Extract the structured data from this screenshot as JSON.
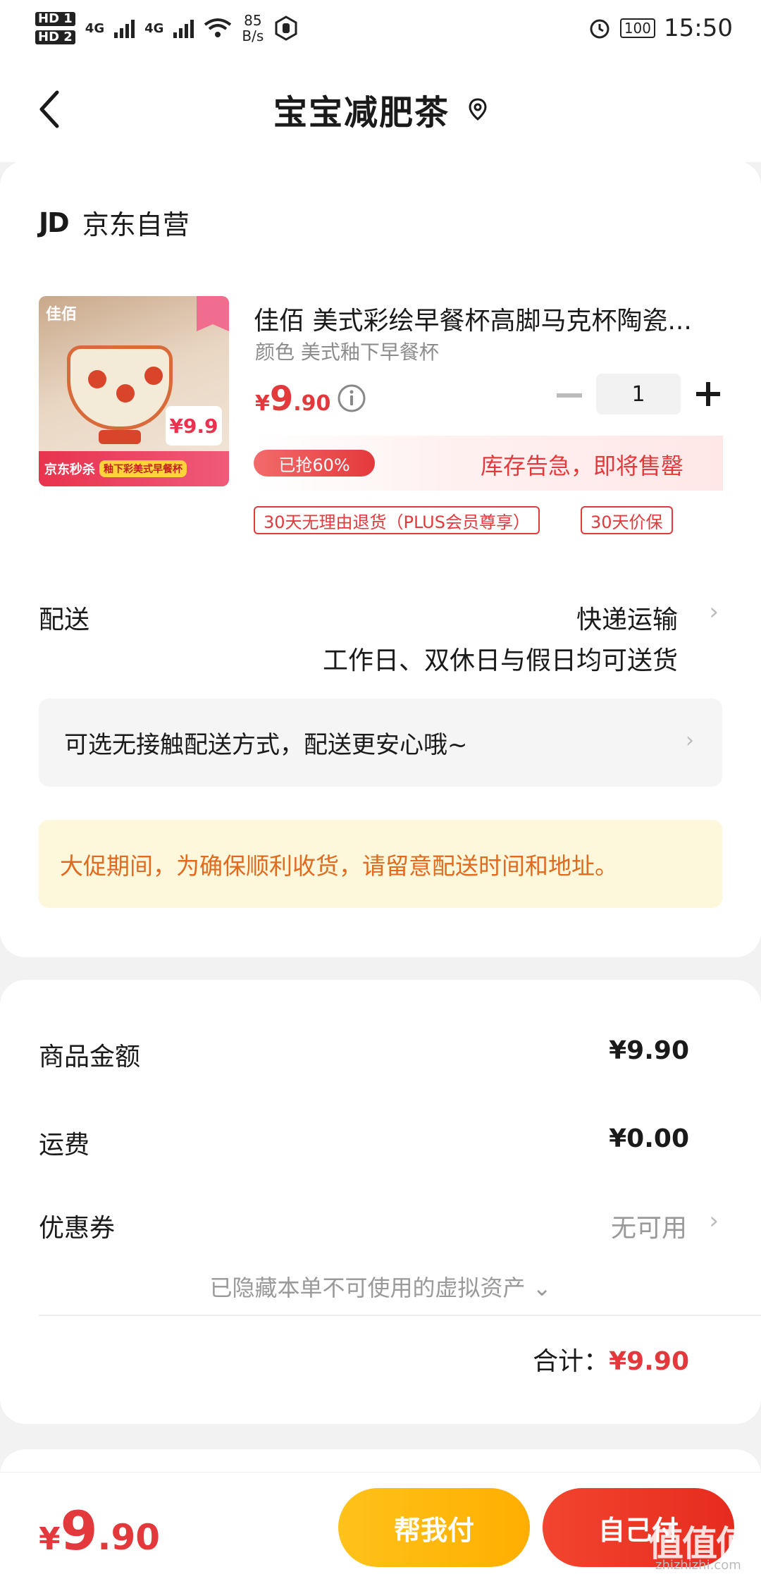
{
  "status_bar": {
    "hd1": "HD 1",
    "hd2": "HD 2",
    "net1": "4G",
    "net2": "4G",
    "speed_value": "85",
    "speed_unit": "B/s",
    "battery": "100",
    "time": "15:50"
  },
  "header": {
    "title": "宝宝减肥茶"
  },
  "shop": {
    "logo": "JD",
    "name": "京东自营"
  },
  "product": {
    "image_brand": "佳佰",
    "image_banner_main": "京东秒杀",
    "image_banner_sub": "釉下彩美式早餐杯",
    "image_price": "¥9.9",
    "title": "佳佰 美式彩绘早餐杯高脚马克杯陶瓷...",
    "variant": "颜色 美式釉下早餐杯",
    "price_currency": "¥",
    "price_int": "9",
    "price_dec": ".90",
    "quantity": "1",
    "stock_progress": "已抢60%",
    "stock_progress_value": 0.6,
    "stock_warning": "库存告急，即将售罄",
    "badges": [
      "30天无理由退货（PLUS会员尊享）",
      "30天价保"
    ]
  },
  "delivery": {
    "label": "配送",
    "method": "快递运输",
    "note": "工作日、双休日与假日均可送货",
    "contactless": "可选无接触配送方式，配送更安心哦~",
    "notice": "大促期间，为确保顺利收货，请留意配送时间和地址。"
  },
  "summary": {
    "goods_label": "商品金额",
    "goods_value": "¥9.90",
    "shipping_label": "运费",
    "shipping_value": "¥0.00",
    "coupon_label": "优惠券",
    "coupon_value": "无可用",
    "hidden_assets": "已隐藏本单不可使用的虚拟资产",
    "total_label": "合计：",
    "total_value": "¥9.90"
  },
  "bottom_bar": {
    "price_currency": "¥",
    "price_int": "9",
    "price_dec": ".90",
    "help_pay": "帮我付",
    "self_pay": "自己付"
  },
  "watermark": {
    "main": "值值值",
    "sub": "zhizhizhi.com"
  },
  "colors": {
    "accent_red": "#e4393c",
    "notice_orange": "#e06a1e",
    "help_button": "#ffb300",
    "self_button": "#e62b1f"
  }
}
